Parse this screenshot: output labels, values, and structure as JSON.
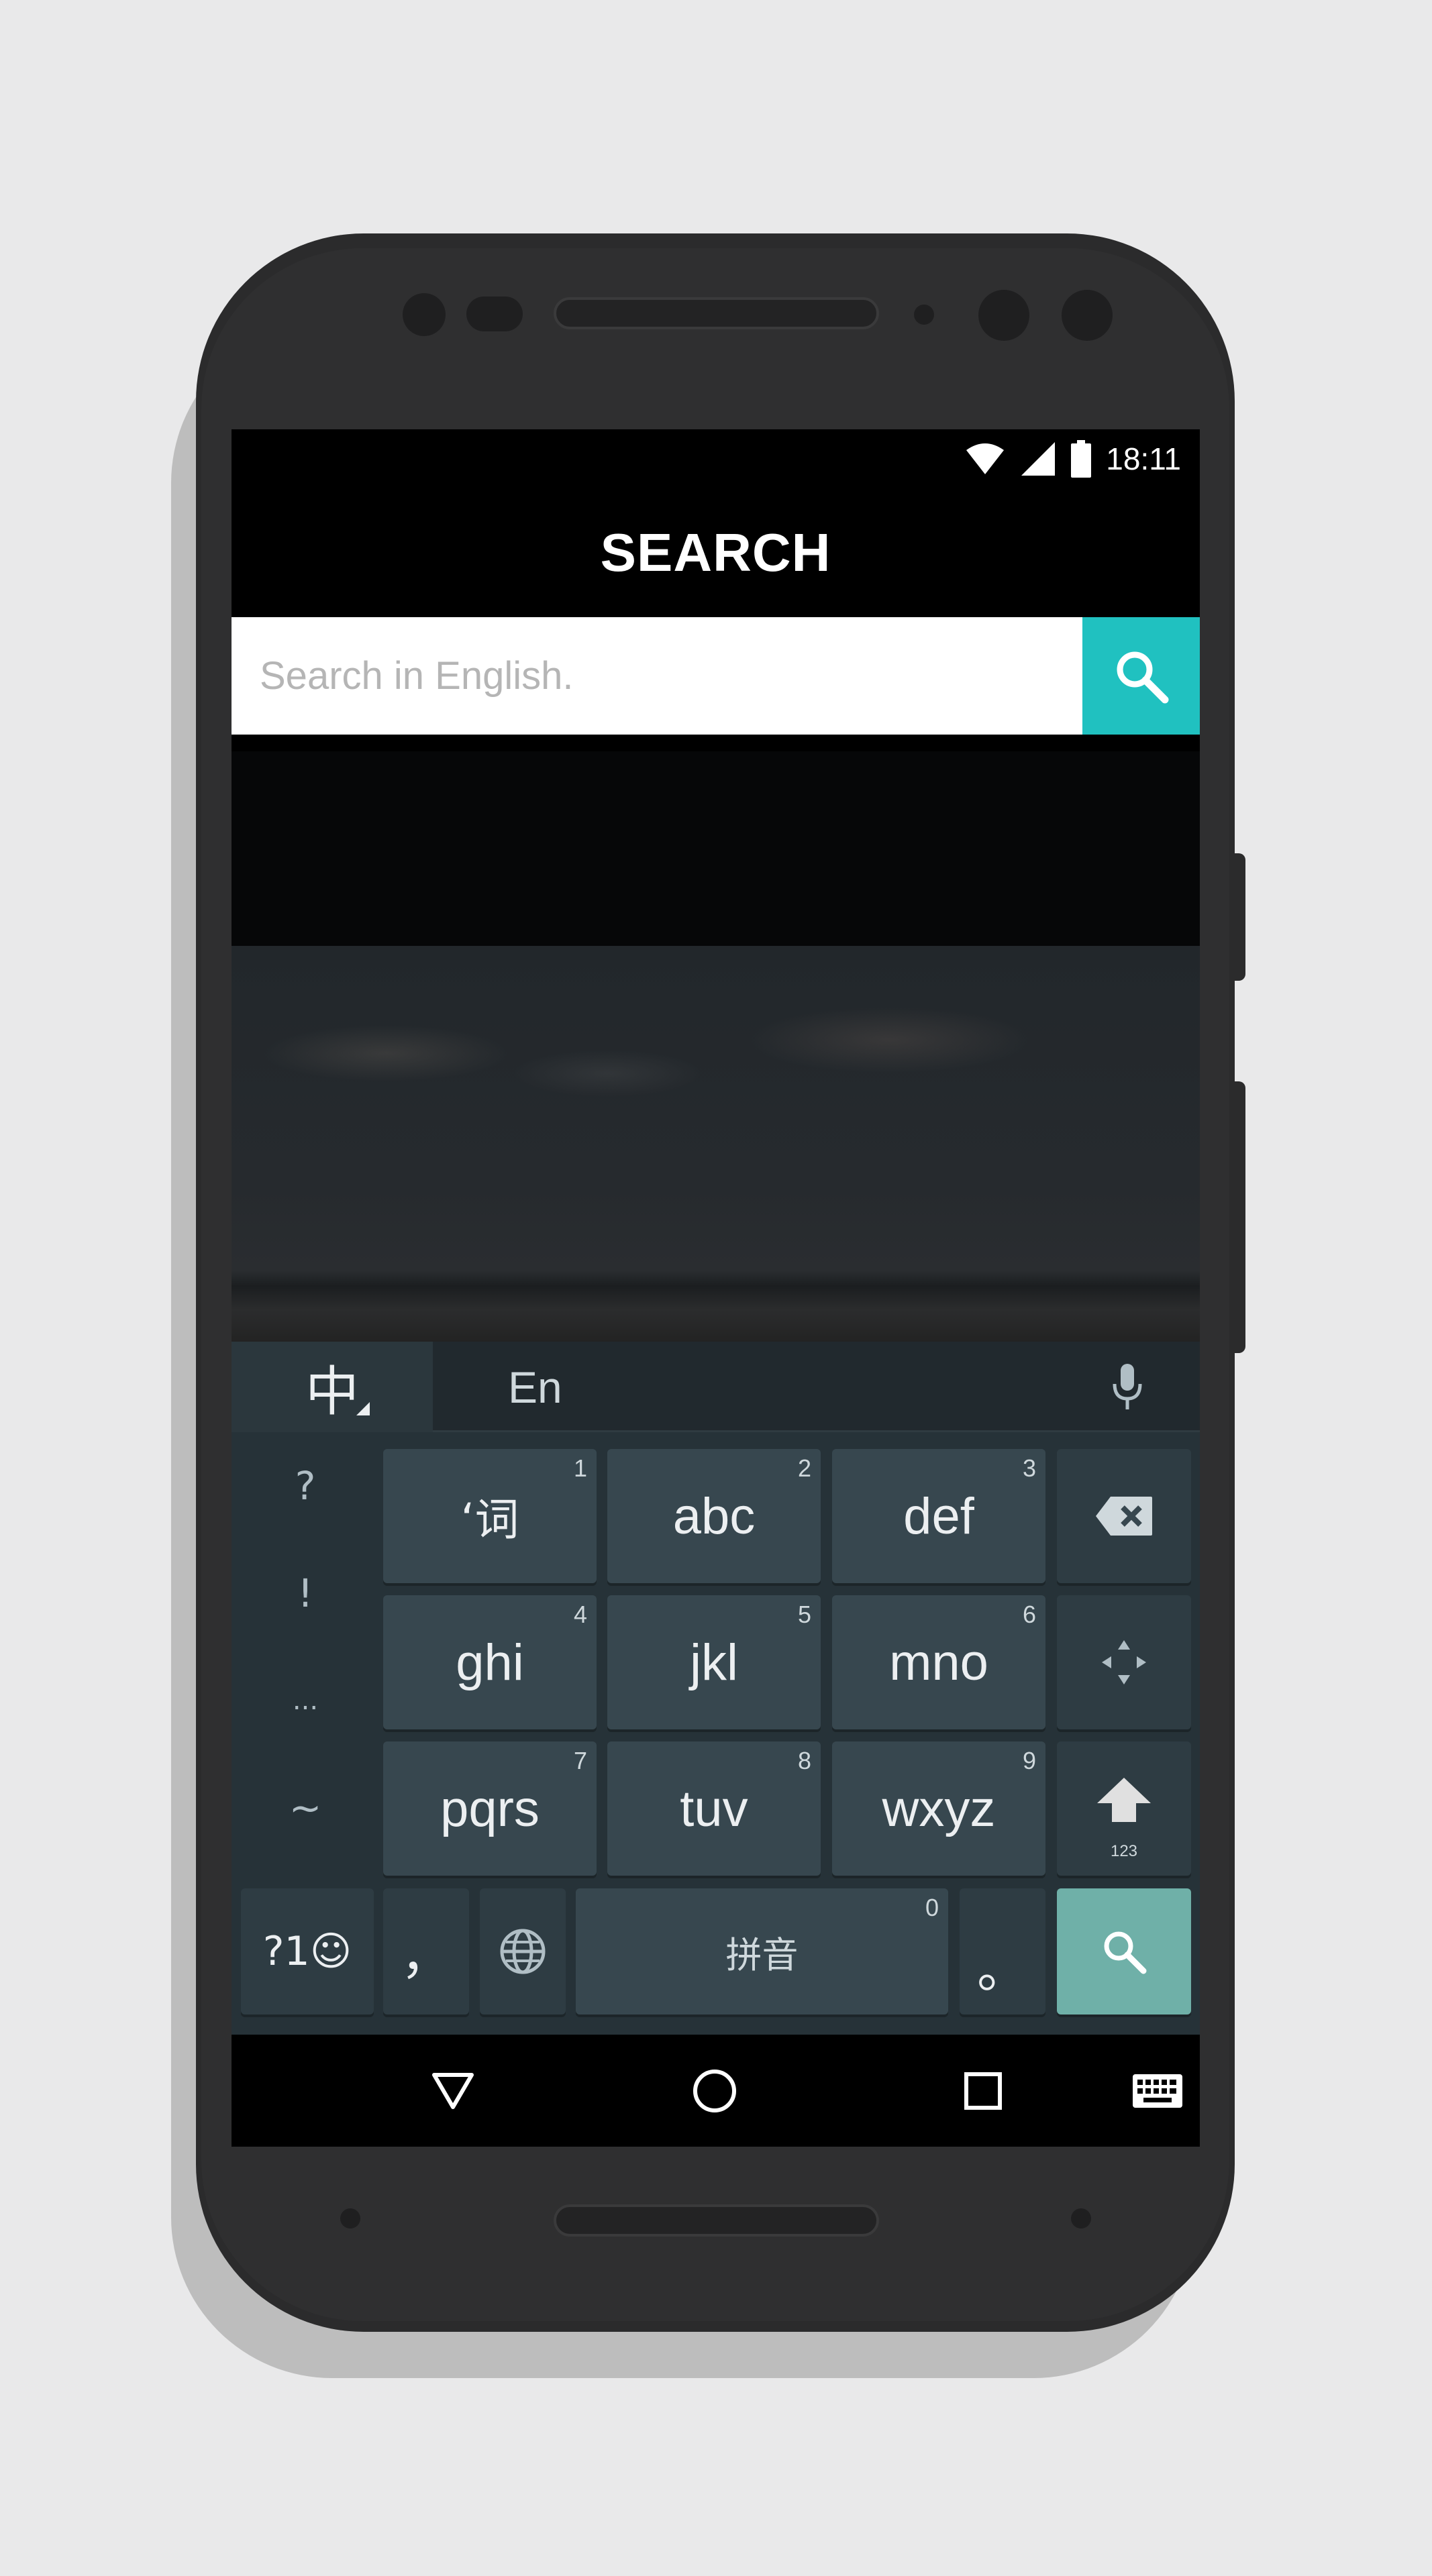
{
  "status_bar": {
    "time": "18:11",
    "icons": [
      "wifi-icon",
      "cell-signal-icon",
      "battery-icon"
    ]
  },
  "app_bar": {
    "title": "SEARCH"
  },
  "search": {
    "placeholder": "Search in English.",
    "value": "",
    "button_icon": "search-icon",
    "accent_color": "#20c1c0"
  },
  "keyboard": {
    "language_primary": "中",
    "language_secondary": "En",
    "mic_icon": "microphone-icon",
    "side_symbols": [
      "?",
      "!",
      "...",
      "~"
    ],
    "keys": [
      {
        "label": "‘词",
        "number": "1"
      },
      {
        "label": "abc",
        "number": "2"
      },
      {
        "label": "def",
        "number": "3"
      },
      {
        "label": "ghi",
        "number": "4"
      },
      {
        "label": "jkl",
        "number": "5"
      },
      {
        "label": "mno",
        "number": "6"
      },
      {
        "label": "pqrs",
        "number": "7"
      },
      {
        "label": "tuv",
        "number": "8"
      },
      {
        "label": "wxyz",
        "number": "9"
      }
    ],
    "backspace_icon": "backspace-icon",
    "cursor_icon": "cursor-move-icon",
    "shift_icon": "shift-arrow-icon",
    "shift_sub": "123",
    "bottom_row": {
      "symbols_label": "?1☺",
      "comma": "，",
      "globe_icon": "globe-icon",
      "space_label": "拼音",
      "space_number": "0",
      "period": "。",
      "enter_icon": "search-icon"
    },
    "enter_color": "#6fb0a8"
  },
  "nav_bar": {
    "back_icon": "back-triangle-icon",
    "home_icon": "home-circle-icon",
    "recents_icon": "recents-square-icon",
    "keyboard_icon": "keyboard-icon"
  }
}
